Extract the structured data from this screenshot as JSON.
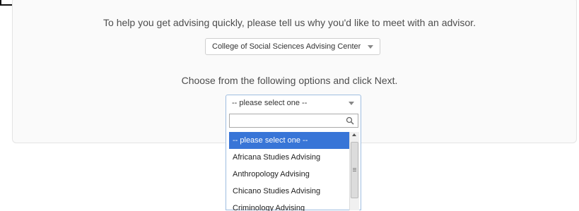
{
  "intro_text": "To help you get advising quickly, please tell us why you'd like to meet with an advisor.",
  "center_select": {
    "value": "College of Social Sciences Advising Center"
  },
  "instructions_text": "Choose from the following options and click Next.",
  "reason_select": {
    "value": "-- please select one --",
    "search_placeholder": "",
    "options": [
      "-- please select one --",
      "Africana Studies Advising",
      "Anthropology Advising",
      "Chicano Studies Advising",
      "Criminology Advising"
    ]
  },
  "colors": {
    "highlight": "#3875d7",
    "focus_border": "#9ebde0"
  }
}
